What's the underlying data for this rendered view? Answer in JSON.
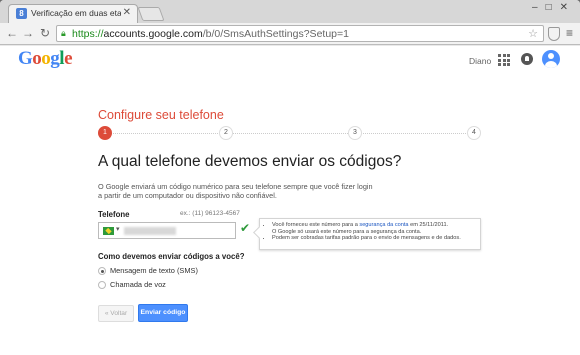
{
  "browser": {
    "tab_title": "Verificação em duas etap",
    "tab_favicon_letter": "8",
    "tab_close": "✕",
    "url_scheme": "https://",
    "url_host": "accounts.google.com",
    "url_path": "/b/0/SmsAuthSettings?Setup=1",
    "icons": [
      "back-icon",
      "forward-icon",
      "reload-icon",
      "lock-icon",
      "star-icon",
      "extension-icon",
      "menu-icon"
    ]
  },
  "header": {
    "logo_letters": [
      "G",
      "o",
      "o",
      "g",
      "l",
      "e"
    ],
    "logo_colors": [
      "#4285f4",
      "#dd4b39",
      "#f4b400",
      "#4285f4",
      "#0f9d58",
      "#dd4b39"
    ],
    "user_name": "Diano"
  },
  "setup": {
    "title": "Configure seu telefone",
    "steps": [
      "1",
      "2",
      "3",
      "4"
    ],
    "active_step": 1,
    "question": "A qual telefone devemos enviar os códigos?",
    "description_line1": "O Google enviará um código numérico para seu telefone sempre que você fizer login",
    "description_line2": "a partir de um computador ou dispositivo não confiável.",
    "phone_label": "Telefone",
    "phone_example": "ex.: (11) 96123-4567",
    "country_caret": "▾",
    "info": {
      "line1_before": "Você forneceu este número para a ",
      "line1_link": "segurança da conta",
      "line1_after": " em 25/11/2011.",
      "line2": "O Google só usará este número para a segurança da conta.",
      "line3": "Podem ser cobradas tarifas padrão para o envio de mensagens e de dados."
    },
    "method_question": "Como devemos enviar códigos a você?",
    "option_sms": "Mensagem de texto (SMS)",
    "option_voice": "Chamada de voz",
    "back_label": "« Voltar",
    "send_label": "Enviar código",
    "accent_color": "#dd4b39",
    "primary_button_color": "#4d90fe"
  }
}
